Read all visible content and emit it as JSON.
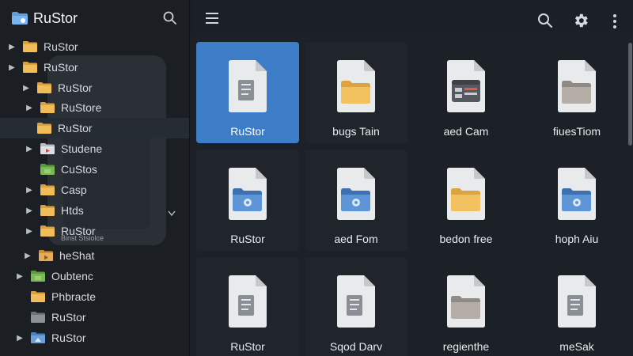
{
  "app": {
    "title": "RuStor"
  },
  "sidebar": {
    "items": [
      {
        "label": "RuStor",
        "sub": "",
        "icon": "folder-icon",
        "expanded": false
      },
      {
        "label": "RuStor",
        "sub": "",
        "icon": "folder-icon",
        "expanded": false
      },
      {
        "label": "RuStor",
        "sub": "",
        "icon": "folder-icon",
        "expanded": false
      },
      {
        "label": "RuStore",
        "sub": "",
        "icon": "folder-icon",
        "expanded": false
      },
      {
        "label": "RuStor",
        "sub": "",
        "icon": "folder-icon",
        "expanded": false,
        "selected": true
      },
      {
        "label": "Studene",
        "sub": "",
        "icon": "media-folder-icon",
        "expanded": false
      },
      {
        "label": "CuStos",
        "sub": "",
        "icon": "green-folder-icon",
        "expanded": false
      },
      {
        "label": "Casp",
        "sub": "",
        "icon": "folder-icon",
        "expanded": false
      },
      {
        "label": "Htds",
        "sub": "",
        "icon": "folder-icon",
        "expanded": false
      },
      {
        "label": "RuStor",
        "sub": "Binst Stsiolce",
        "icon": "folder-icon",
        "expanded": false
      },
      {
        "label": "heShat",
        "sub": "",
        "icon": "video-folder-icon",
        "expanded": false
      },
      {
        "label": "Oubtenc",
        "sub": "",
        "icon": "green-folder-icon",
        "expanded": false
      },
      {
        "label": "Phbracte",
        "sub": "",
        "icon": "folder-icon",
        "expanded": false
      },
      {
        "label": "RuStor",
        "sub": "",
        "icon": "gray-folder-icon",
        "expanded": false
      },
      {
        "label": "RuStor",
        "sub": "",
        "icon": "blue-folder-icon",
        "expanded": false
      }
    ]
  },
  "main": {
    "tiles": [
      {
        "label": "RuStor",
        "icon": "document-icon",
        "selected": true
      },
      {
        "label": "bugs Tain",
        "icon": "yellow-folder-document-icon"
      },
      {
        "label": "aed Cam",
        "icon": "app-window-document-icon"
      },
      {
        "label": "fiuesTiom",
        "icon": "gray-folder-document-icon"
      },
      {
        "label": "RuStor",
        "icon": "blue-folder-document-icon"
      },
      {
        "label": "aed Fom",
        "icon": "blue-folder-document-icon"
      },
      {
        "label": "bedon free",
        "icon": "yellow-folder-document-icon"
      },
      {
        "label": "hoph Aiu",
        "icon": "blue-folder-document-icon"
      },
      {
        "label": "RuStor",
        "icon": "document-icon"
      },
      {
        "label": "Sqod Darv",
        "icon": "document-icon"
      },
      {
        "label": "regienthe",
        "icon": "gray-folder-document-icon"
      },
      {
        "label": "meSak",
        "icon": "document-icon"
      }
    ]
  },
  "colors": {
    "accent": "#3d7dc8",
    "folder": "#e8b04a",
    "sidebar_bg": "#1b1f24",
    "content_bg": "#1c2127"
  }
}
